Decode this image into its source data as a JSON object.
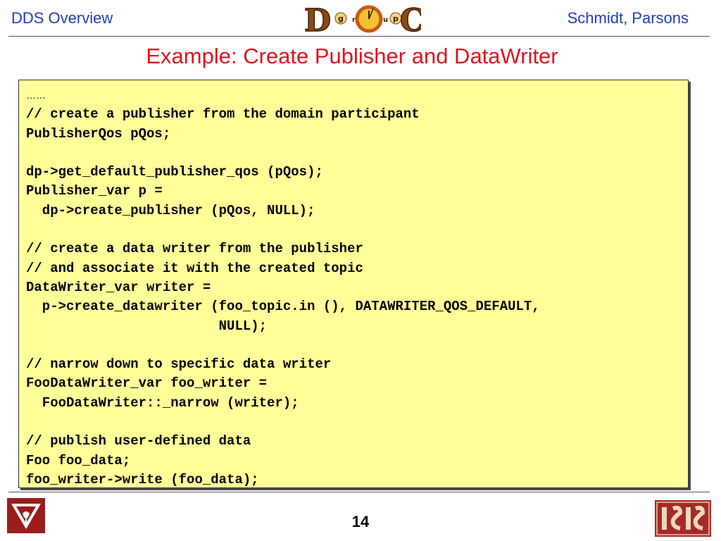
{
  "header": {
    "left_title": "DDS Overview",
    "authors": "Schmidt, Parsons",
    "logo_letters": [
      "D",
      "g",
      "r",
      "o",
      "u",
      "p",
      "C"
    ]
  },
  "slide": {
    "title": "Example: Create Publisher and DataWriter",
    "page_number": "14"
  },
  "code": [
    "……",
    "// create a publisher from the domain participant",
    "PublisherQos pQos;",
    "",
    "dp->get_default_publisher_qos (pQos);",
    "Publisher_var p =",
    "  dp->create_publisher (pQos, NULL);",
    "",
    "// create a data writer from the publisher",
    "// and associate it with the created topic",
    "DataWriter_var writer =",
    "  p->create_datawriter (foo_topic.in (), DATAWRITER_QOS_DEFAULT,",
    "                        NULL);",
    "",
    "// narrow down to specific data writer",
    "FooDataWriter_var foo_writer =",
    "  FooDataWriter::_narrow (writer);",
    "",
    "// publish user-defined data",
    "Foo foo_data;",
    "foo_writer->write (foo_data);"
  ],
  "colors": {
    "header_text": "#1f3fbf",
    "title_text": "#e0141e",
    "code_background": "#ffff99",
    "vanderbilt_red": "#9b1c1c",
    "isis_red": "#a52a2a"
  },
  "icons": {
    "doc_logo": "doc-group-logo",
    "left_logo": "vanderbilt-logo",
    "right_logo": "isis-logo"
  }
}
